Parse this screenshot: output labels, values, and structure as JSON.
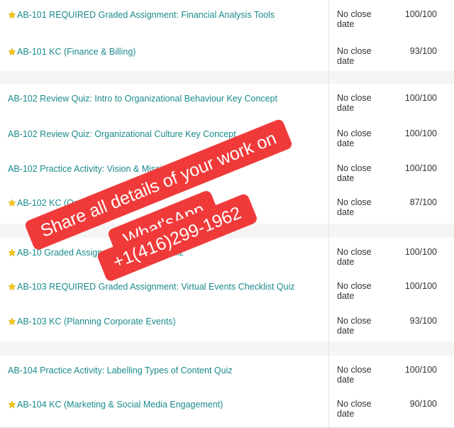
{
  "rows": [
    {
      "starred": true,
      "title": "AB-101 REQUIRED Graded Assignment: Financial Analysis Tools",
      "date_line1": "No close",
      "date_line2": "date",
      "score": "100/100"
    },
    {
      "starred": true,
      "title": "AB-101 KC (Finance & Billing)",
      "date_line1": "No close",
      "date_line2": "date",
      "score": "93/100"
    },
    {
      "starred": false,
      "title": "AB-102 Review Quiz: Intro to Organizational Behaviour Key Concept",
      "date_line1": "No close",
      "date_line2": "date",
      "score": "100/100"
    },
    {
      "starred": false,
      "title": "AB-102 Review Quiz: Organizational Culture Key Concept",
      "date_line1": "No close",
      "date_line2": "date",
      "score": "100/100"
    },
    {
      "starred": false,
      "title": "AB-102 Practice Activity: Vision & Mission Stateme",
      "date_line1": "No close",
      "date_line2": "date",
      "score": "100/100"
    },
    {
      "starred": true,
      "title": "AB-102 KC (Organizati",
      "date_line1": "No close",
      "date_line2": "date",
      "score": "87/100"
    },
    {
      "starred": true,
      "title": "AB-10 Graded Assign                    g Key Concept Quiz",
      "date_line1": "No close",
      "date_line2": "date",
      "score": "100/100"
    },
    {
      "starred": true,
      "title": "AB-103 REQUIRED Graded Assignment: Virtual Events Checklist Quiz",
      "date_line1": "No close",
      "date_line2": "date",
      "score": "100/100"
    },
    {
      "starred": true,
      "title": "AB-103 KC (Planning Corporate Events)",
      "date_line1": "No close",
      "date_line2": "date",
      "score": "93/100"
    },
    {
      "starred": false,
      "title": "AB-104 Practice Activity: Labelling Types of Content Quiz",
      "date_line1": "No close",
      "date_line2": "date",
      "score": "100/100"
    },
    {
      "starred": true,
      "title": "AB-104 KC (Marketing & Social Media Engagement)",
      "date_line1": "No close",
      "date_line2": "date",
      "score": "90/100"
    }
  ],
  "watermark": {
    "line1": "Share all details of your work on",
    "line2": "What'sApp",
    "line3": "+1(416)299-1962",
    "color": "#f03a3a"
  },
  "colors": {
    "link": "#1a8a8c",
    "star": "#f5c518",
    "gap_row": "#f5f5f5"
  }
}
